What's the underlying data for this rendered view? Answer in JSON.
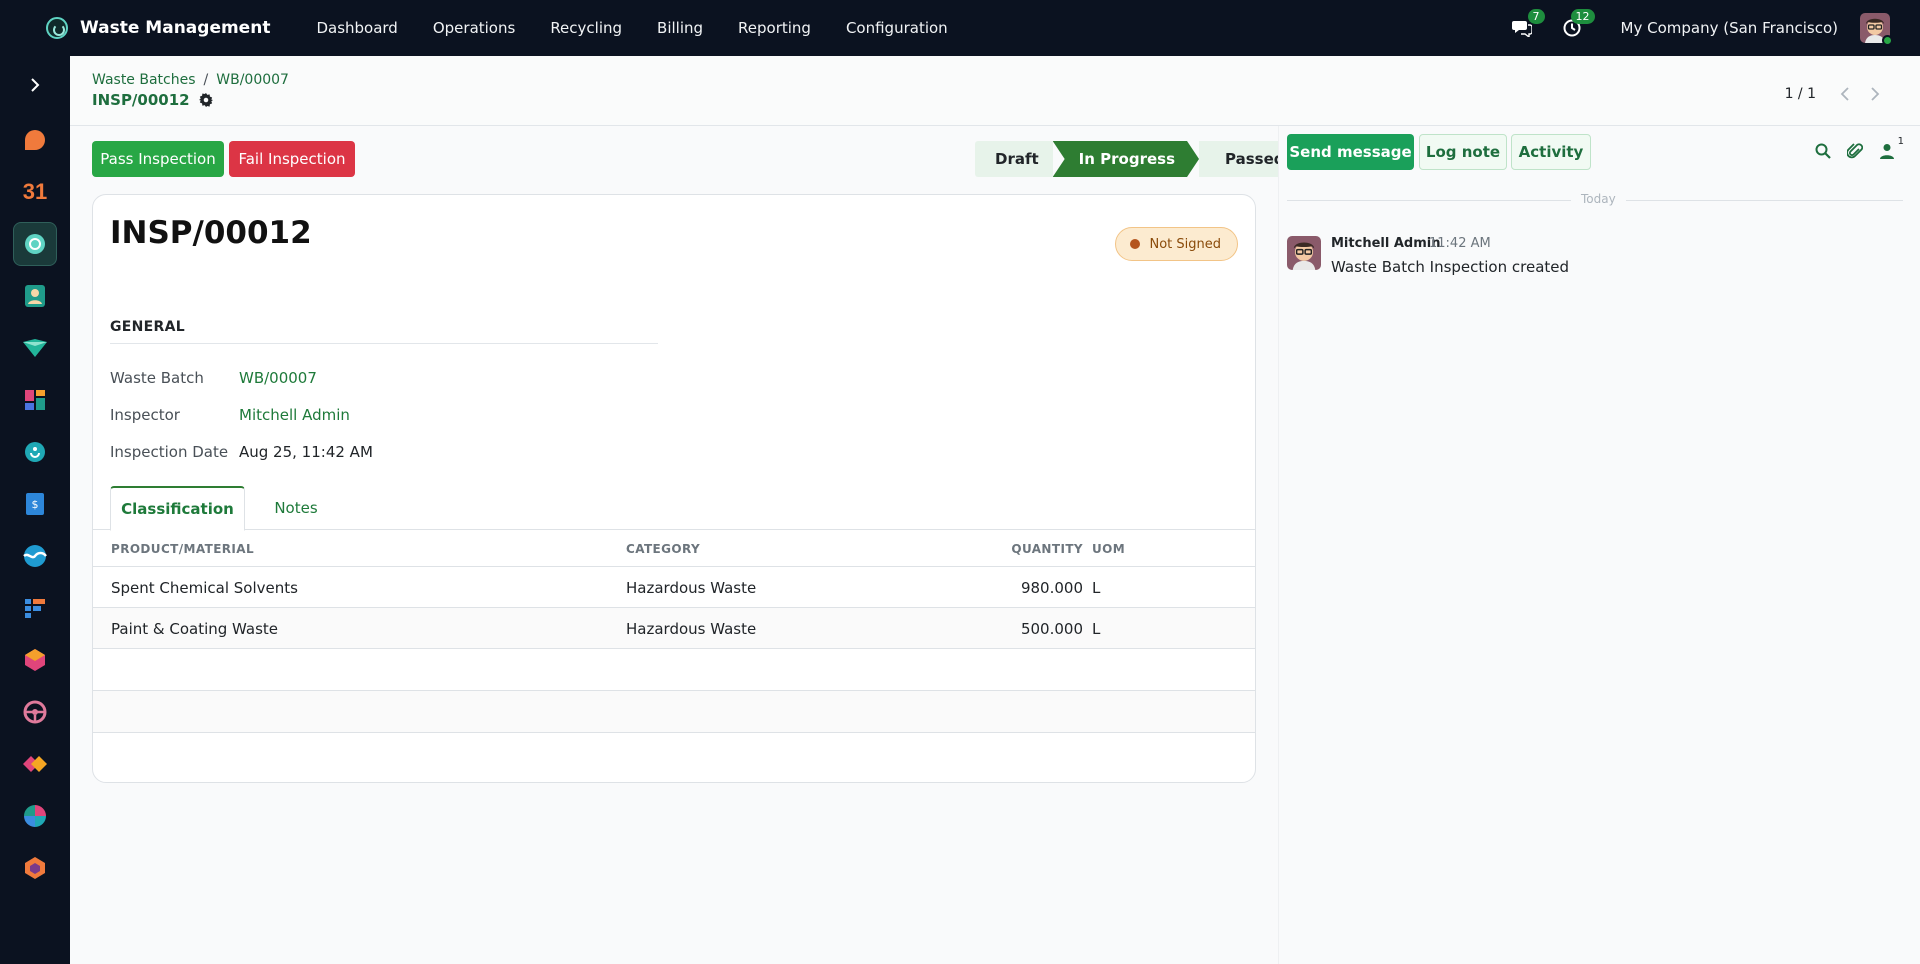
{
  "app": {
    "title": "Waste Management",
    "brand_color": "#0b1220",
    "accent_color": "#2e7d32"
  },
  "menu": [
    {
      "label": "Dashboard"
    },
    {
      "label": "Operations"
    },
    {
      "label": "Recycling"
    },
    {
      "label": "Billing"
    },
    {
      "label": "Reporting"
    },
    {
      "label": "Configuration"
    }
  ],
  "systray": {
    "messages_count": "7",
    "activities_count": "12",
    "company": "My Company (San Francisco)"
  },
  "sidebar": {
    "apps": [
      {
        "icon": "discuss-icon"
      },
      {
        "icon": "calendar-icon",
        "label": "31"
      },
      {
        "icon": "waste-management-icon"
      },
      {
        "icon": "contacts-icon"
      },
      {
        "icon": "crm-icon"
      },
      {
        "icon": "dashboards-icon"
      },
      {
        "icon": "recycling-icon"
      },
      {
        "icon": "invoicing-icon"
      },
      {
        "icon": "website-icon"
      },
      {
        "icon": "project-icon"
      },
      {
        "icon": "inventory-icon"
      },
      {
        "icon": "fleet-icon"
      },
      {
        "icon": "sign-icon"
      },
      {
        "icon": "timesheets-icon"
      },
      {
        "icon": "apps-icon"
      }
    ]
  },
  "breadcrumb": {
    "items": [
      "Waste Batches",
      "WB/00007"
    ],
    "separator": "/",
    "current": "INSP/00012"
  },
  "pager": {
    "value": "1 / 1"
  },
  "actions": {
    "pass": "Pass Inspection",
    "fail": "Fail Inspection"
  },
  "statusbar": {
    "stages": [
      "Draft",
      "In Progress",
      "Passed"
    ],
    "current": "In Progress"
  },
  "record": {
    "name": "INSP/00012",
    "ribbon": "Not Signed",
    "group_title": "GENERAL",
    "fields": [
      {
        "label": "Waste Batch",
        "value": "WB/00007"
      },
      {
        "label": "Inspector",
        "value": "Mitchell Admin"
      },
      {
        "label": "Inspection Date",
        "value": "Aug 25, 11:42 AM"
      }
    ]
  },
  "tabs": [
    {
      "label": "Classification",
      "active": true
    },
    {
      "label": "Notes",
      "active": false
    }
  ],
  "lines": {
    "headers": [
      "PRODUCT/MATERIAL",
      "CATEGORY",
      "QUANTITY",
      "UOM"
    ],
    "rows": [
      [
        "Spent Chemical Solvents",
        "Hazardous Waste",
        "980.000",
        "L"
      ],
      [
        "Paint & Coating Waste",
        "Hazardous Waste",
        "500.000",
        "L"
      ]
    ]
  },
  "chatter": {
    "send_message": "Send message",
    "log_note": "Log note",
    "activity": "Activity",
    "followers_count": "1",
    "date_separator": "Today",
    "messages": [
      {
        "author": "Mitchell Admin",
        "time": "11:42 AM",
        "body": "Waste Batch Inspection created"
      }
    ]
  }
}
